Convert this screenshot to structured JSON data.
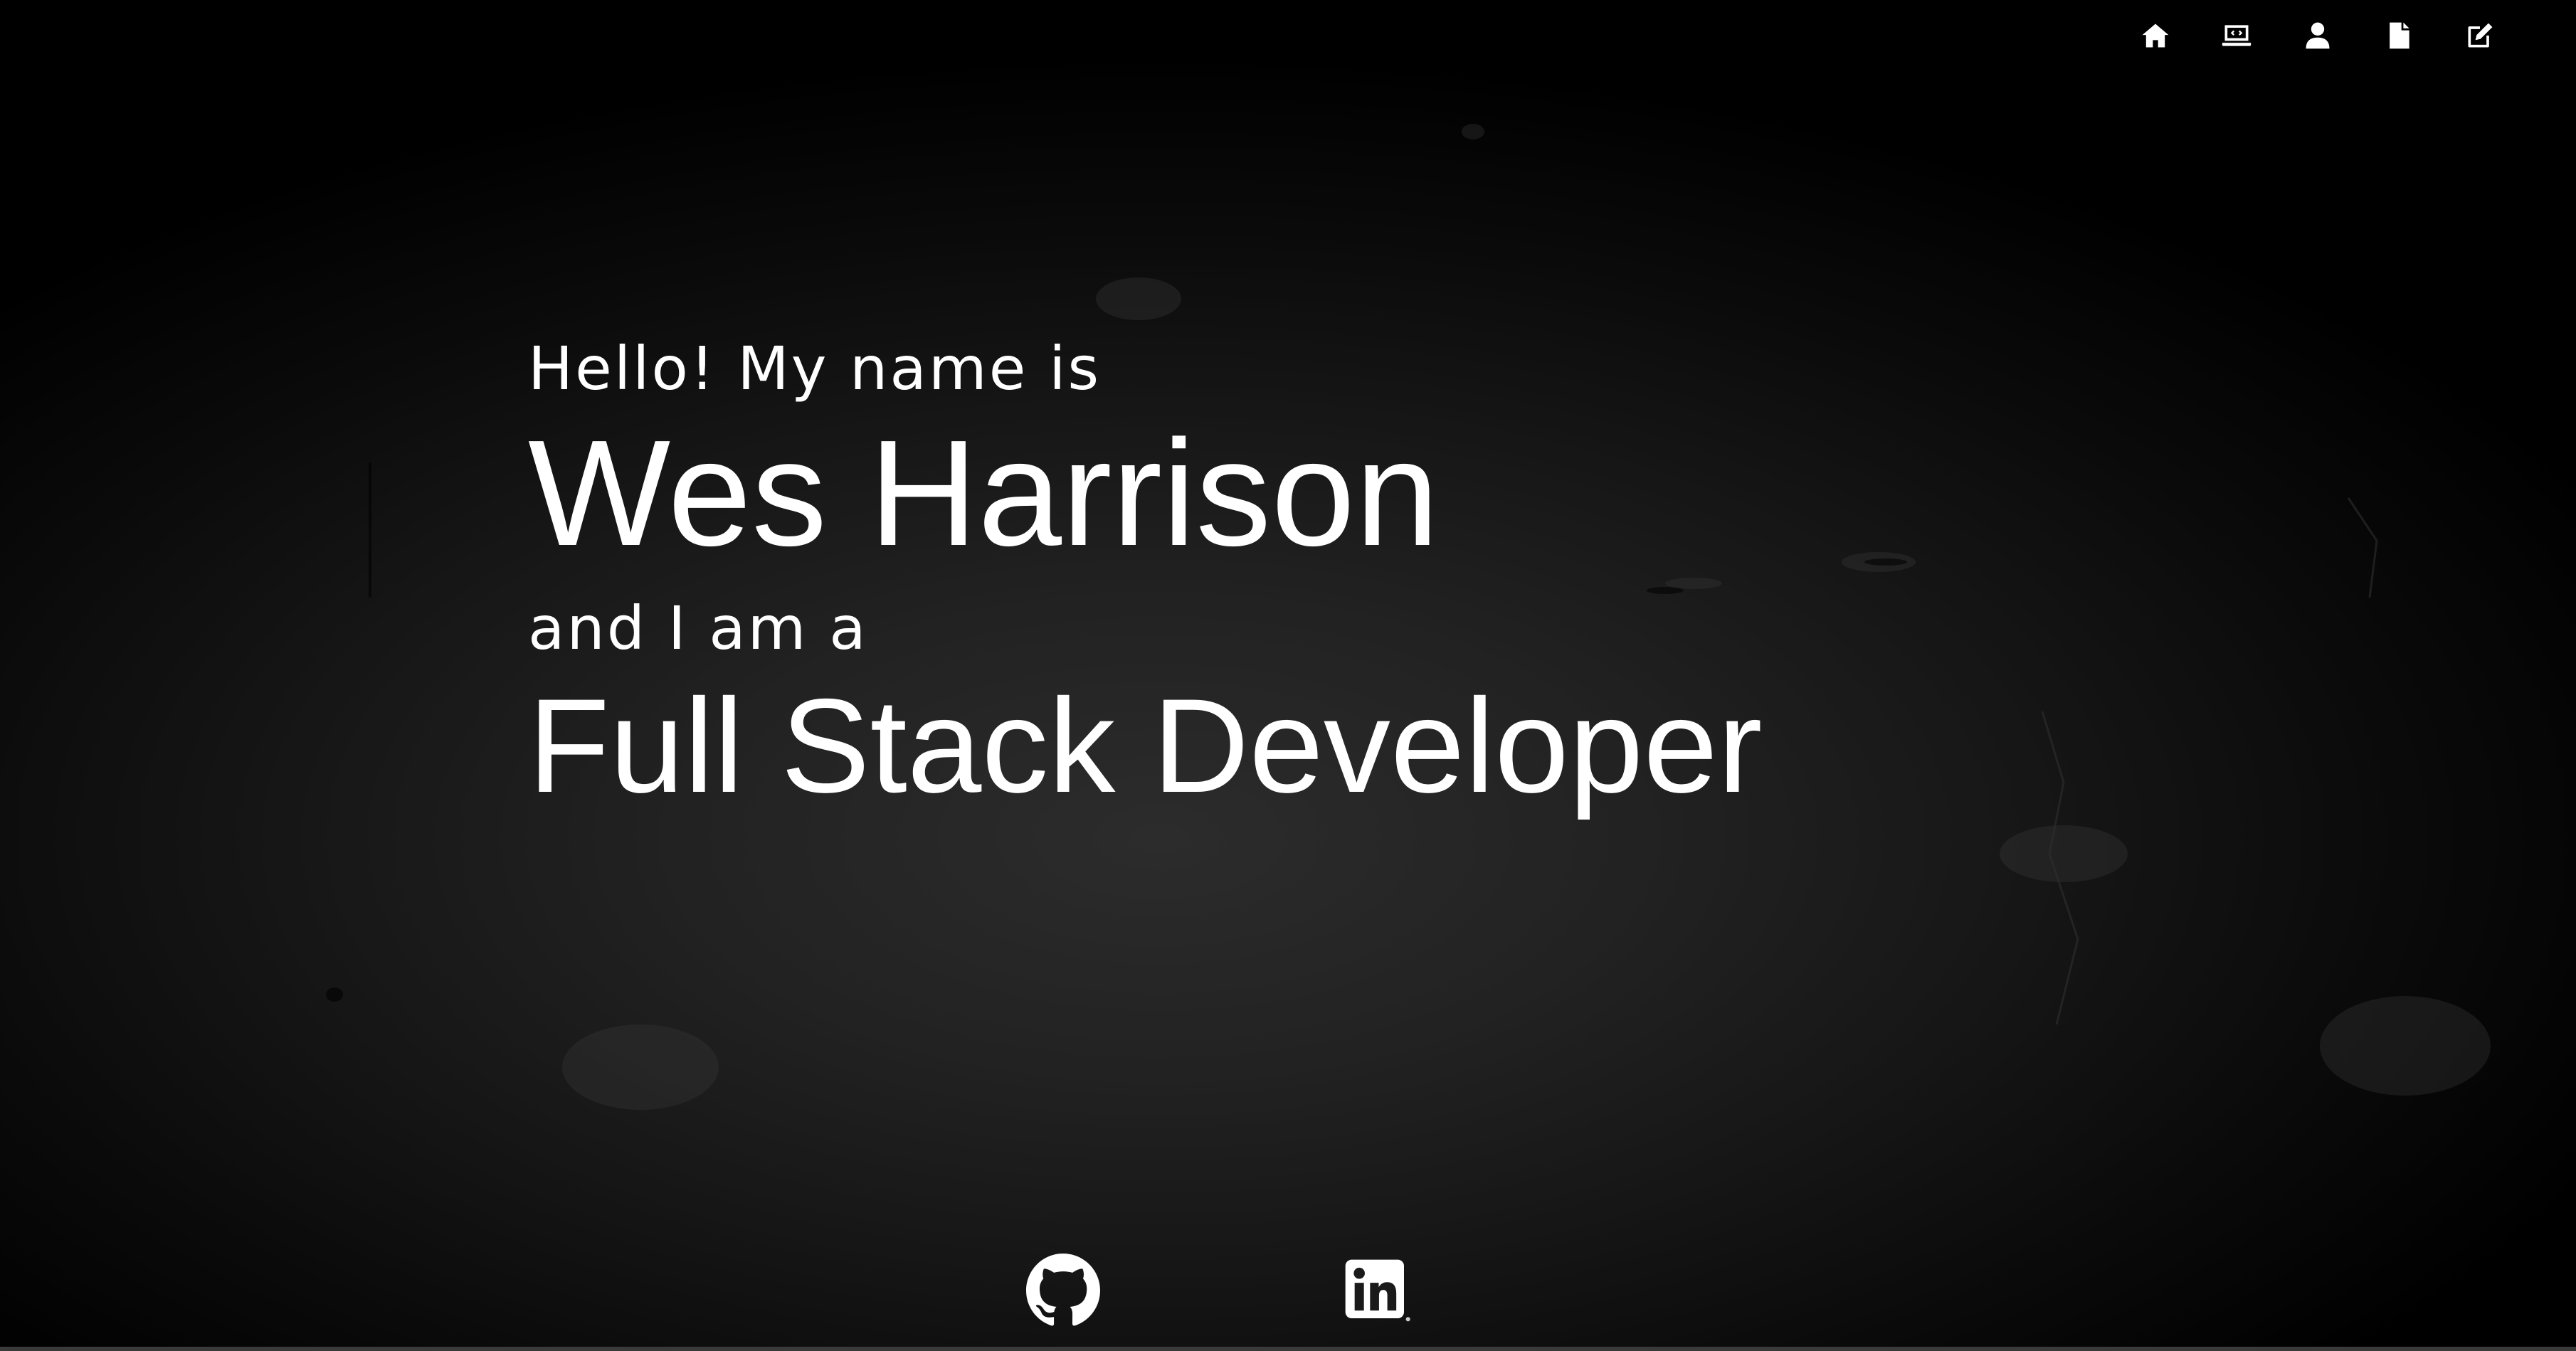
{
  "nav": {
    "items": [
      {
        "icon": "home-icon",
        "label": "Home"
      },
      {
        "icon": "projects-icon",
        "label": "Projects"
      },
      {
        "icon": "about-icon",
        "label": "About"
      },
      {
        "icon": "resume-icon",
        "label": "Resume"
      },
      {
        "icon": "contact-icon",
        "label": "Contact"
      }
    ]
  },
  "hero": {
    "greeting": "Hello! My name is",
    "name": "Wes Harrison",
    "intro": "and I am a",
    "role": "Full Stack Developer"
  },
  "social": {
    "github_icon": "github-icon",
    "linkedin_icon": "linkedin-icon"
  },
  "colors": {
    "text": "#ffffff",
    "background": "#1c1c1c"
  }
}
